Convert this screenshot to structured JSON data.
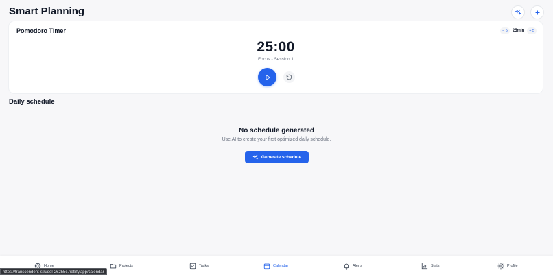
{
  "header": {
    "title": "Smart Planning",
    "ai_icon": "sparkles-icon",
    "add_icon": "plus-icon"
  },
  "pomodoro": {
    "title": "Pomodoro Timer",
    "decrease_label": "− 5",
    "duration_label": "25min",
    "increase_label": "+ 5",
    "time": "25:00",
    "session": "Focus - Session 1",
    "play_icon": "play-icon",
    "reset_icon": "reset-icon"
  },
  "schedule": {
    "title": "Daily schedule",
    "empty_title": "No schedule generated",
    "empty_subtitle": "Use AI to create your first optimized daily schedule.",
    "generate_label": "Generate schedule"
  },
  "nav": {
    "items": [
      {
        "label": "Home",
        "icon": "home-icon",
        "active": false
      },
      {
        "label": "Projects",
        "icon": "folder-icon",
        "active": false
      },
      {
        "label": "Tasks",
        "icon": "checkbox-icon",
        "active": false
      },
      {
        "label": "Calendar",
        "icon": "calendar-icon",
        "active": true
      },
      {
        "label": "Alerts",
        "icon": "bell-icon",
        "active": false
      },
      {
        "label": "Stats",
        "icon": "bar-chart-icon",
        "active": false
      },
      {
        "label": "Profile",
        "icon": "gear-icon",
        "active": false
      }
    ]
  },
  "status_bar": {
    "url": "https://transcendent-strudel-26255c.netlify.app/calendar"
  },
  "colors": {
    "accent": "#2563eb",
    "background": "#f7f7f9",
    "text": "#111827",
    "muted": "#6b7280"
  }
}
